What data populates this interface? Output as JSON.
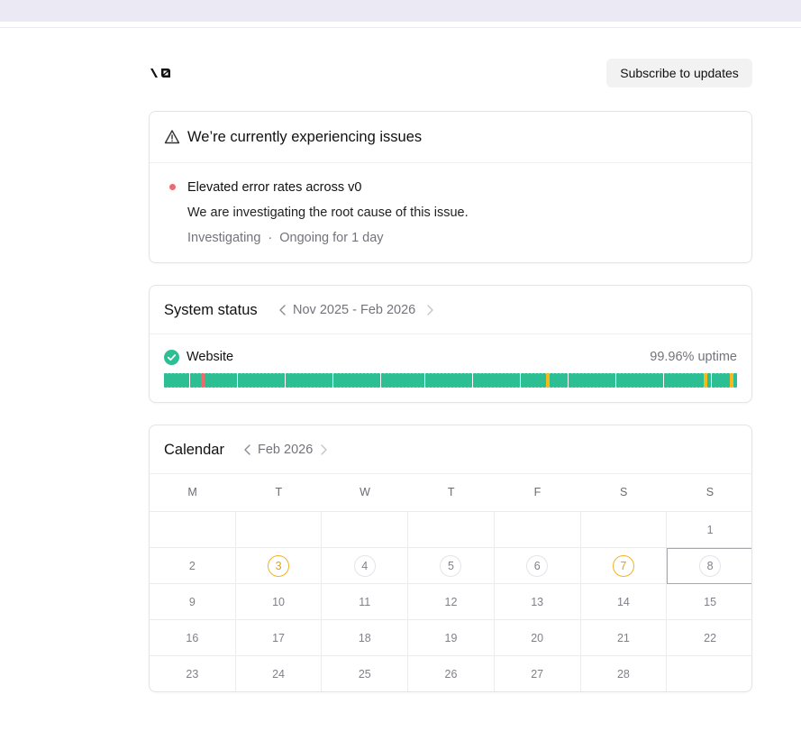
{
  "header": {
    "logo_text": "v0",
    "subscribe_label": "Subscribe to updates"
  },
  "incident": {
    "title": "We’re currently experiencing issues",
    "name": "Elevated error rates across v0",
    "description": "We are investigating the root cause of this issue.",
    "state": "Investigating",
    "separator": "·",
    "duration": "Ongoing for 1 day"
  },
  "system_status": {
    "title": "System status",
    "range": "Nov 2025 - Feb 2026",
    "services": [
      {
        "name": "Website",
        "uptime": "99.96% uptime",
        "status": "operational",
        "daily": "ggggggggggrgggggggggggggggggggggggggggggggggggggggggggggggggggggggggggggggggggggggggggggggggggggggggggggyggggggggggggggggggggggggggggggggggggggggggyggggggyg"
      }
    ]
  },
  "calendar": {
    "title": "Calendar",
    "month": "Feb 2026",
    "weekdays": [
      "M",
      "T",
      "W",
      "T",
      "F",
      "S",
      "S"
    ],
    "weeks": [
      [
        null,
        null,
        null,
        null,
        null,
        null,
        1
      ],
      [
        2,
        3,
        4,
        5,
        6,
        7,
        8
      ],
      [
        9,
        10,
        11,
        12,
        13,
        14,
        15
      ],
      [
        16,
        17,
        18,
        19,
        20,
        21,
        22
      ],
      [
        23,
        24,
        25,
        26,
        27,
        28,
        null
      ]
    ],
    "incident_days": [
      3,
      7
    ],
    "ringed_days": [
      4,
      5,
      6,
      8
    ],
    "selected_day": 8
  },
  "colors": {
    "operational": "#2bbf93",
    "degraded": "#f5b91d",
    "outage": "#ef6b6b",
    "incident_dot": "#ef6b6b"
  }
}
